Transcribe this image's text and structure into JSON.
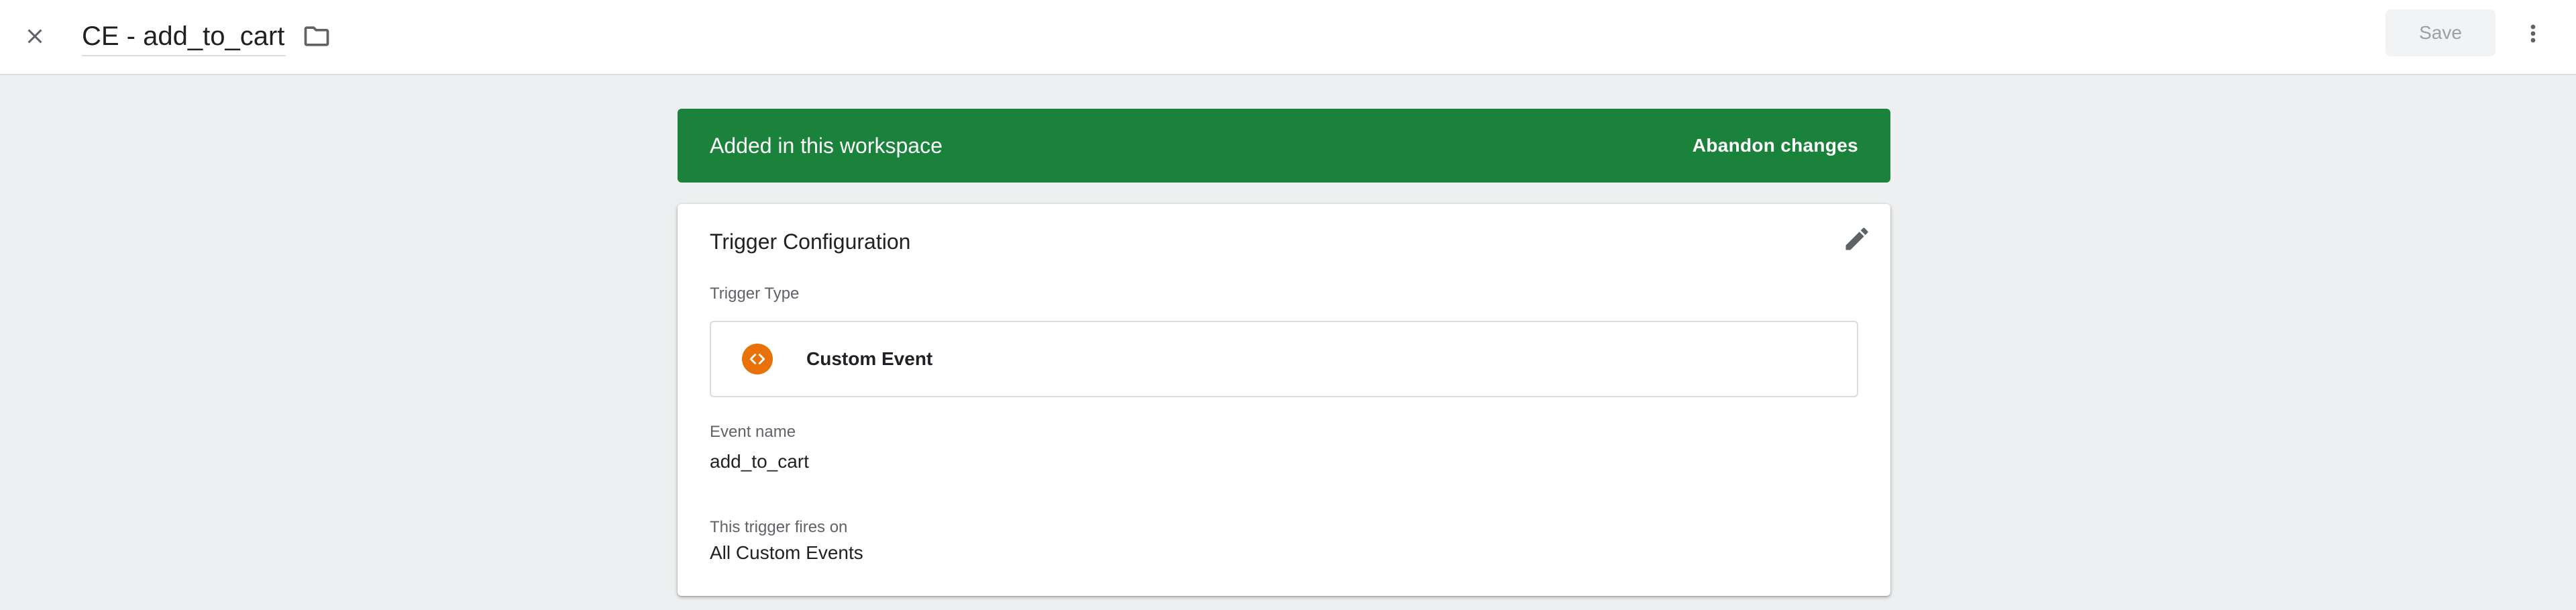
{
  "header": {
    "title": "CE - add_to_cart",
    "save_label": "Save",
    "icons": {
      "close": "close-icon",
      "folder": "folder-icon",
      "more": "more-vert-icon"
    }
  },
  "banner": {
    "text": "Added in this workspace",
    "action_label": "Abandon changes",
    "color": "#1a823b"
  },
  "card": {
    "title": "Trigger Configuration",
    "edit_icon": "pencil-icon",
    "trigger_type_label": "Trigger Type",
    "trigger_type": {
      "name": "Custom Event",
      "icon": "code-brackets-icon",
      "icon_color": "#e8710a"
    },
    "event_name_label": "Event name",
    "event_name": "add_to_cart",
    "fires_on_label": "This trigger fires on",
    "fires_on": "All Custom Events"
  }
}
